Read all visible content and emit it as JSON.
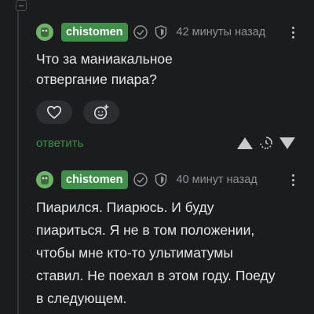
{
  "comments": [
    {
      "username": "chistomen",
      "time": "42 минуты назад",
      "text_lines": [
        "Что за маниакальное",
        "отвергание пиара?"
      ],
      "reply_label": "ответить",
      "icons": {
        "avatar": "avatar-icon",
        "check": "verified-check-icon",
        "shield": "shield-badge-icon",
        "more": "more-vertical-icon",
        "like": "heart-icon",
        "emoji": "add-emoji-icon",
        "up": "vote-up-icon",
        "pending": "rating-pending-icon",
        "down": "vote-down-icon"
      }
    },
    {
      "username": "chistomen",
      "time": "40 минут назад",
      "text_lines": [
        "Пиарился. Пиарюсь. И буду",
        "пиариться. Я не в том положении,",
        "чтобы мне кто-то ультиматумы",
        "ставил. Не поехал в этом году. Поеду",
        "в следующем."
      ]
    }
  ],
  "colors": {
    "background": "#1b1c1e",
    "username_bg": "#3f8f4a",
    "reply": "#3f8f4a",
    "muted": "#8f9196"
  }
}
